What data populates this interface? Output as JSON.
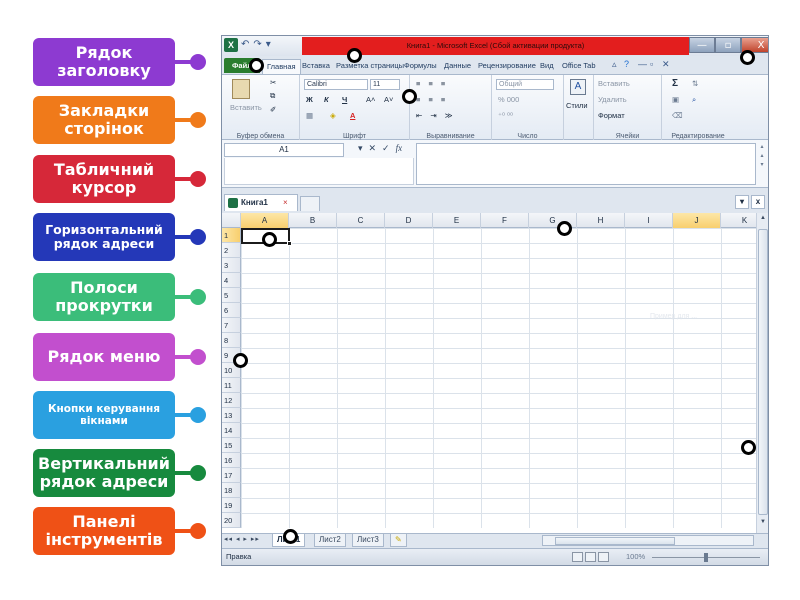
{
  "labels": [
    {
      "text": "Рядок заголовку",
      "color": "#8d3ad1"
    },
    {
      "text": "Закладки сторінок",
      "color": "#f07a1a"
    },
    {
      "text": "Табличний курсор",
      "color": "#d62839"
    },
    {
      "text": "Горизонтальний рядок адреси",
      "color": "#2438b8"
    },
    {
      "text": "Полоси прокрутки",
      "color": "#3bbd7a"
    },
    {
      "text": "Рядок меню",
      "color": "#c24fce"
    },
    {
      "text": "Кнопки керування вікнами",
      "color": "#2aa0e0"
    },
    {
      "text": "Вертикальний рядок адреси",
      "color": "#178a3e"
    },
    {
      "text": "Панелі інструментів",
      "color": "#ef5116"
    }
  ],
  "excel": {
    "title": "Книга1 - Microsoft Excel (Сбой активации продукта)",
    "qat_icon": "X",
    "qat": [
      "↶",
      "↷",
      "▾"
    ],
    "window_controls": [
      "—",
      "▫",
      "X"
    ],
    "tabs": [
      "Файл",
      "Главная",
      "Вставка",
      "Разметка страницы",
      "Формулы",
      "Данные",
      "Рецензирование",
      "Вид",
      "Office Tab"
    ],
    "tab_right_icons": [
      "▵",
      "?",
      "—",
      "▫",
      "✕"
    ],
    "ribbon": {
      "clipboard": {
        "paste": "Вставить",
        "name": "Буфер обмена"
      },
      "font": {
        "name_value": "Calibri",
        "size_value": "11",
        "bold": "Ж",
        "italic": "К",
        "underline": "Ч",
        "grow": "A˄",
        "shrink": "A˅",
        "color": "A",
        "group": "Шрифт"
      },
      "alignment": {
        "group": "Выравнивание"
      },
      "number": {
        "format": "Общий",
        "percent": "% 000",
        "group": "Число"
      },
      "styles": {
        "label": "Стили"
      },
      "cells": {
        "insert": "Вставить",
        "delete": "Удалить",
        "format": "Формат",
        "group": "Ячейки"
      },
      "editing": {
        "sum": "Σ",
        "group": "Редактирование"
      }
    },
    "name_box": "A1",
    "formula_buttons": [
      "▾",
      "✕",
      "✓",
      "fx"
    ],
    "doc_tab": {
      "label": "Книга1",
      "close": "×"
    },
    "doc_controls": [
      "▾",
      "x"
    ],
    "columns": [
      "A",
      "B",
      "C",
      "D",
      "E",
      "F",
      "G",
      "H",
      "I",
      "J",
      "K"
    ],
    "rows": [
      "1",
      "2",
      "3",
      "4",
      "5",
      "6",
      "7",
      "8",
      "9",
      "10",
      "11",
      "12",
      "13",
      "14",
      "15",
      "16",
      "17",
      "18",
      "19",
      "20"
    ],
    "selected_cell": "A1",
    "watermark": "Пример для ...",
    "sheet_nav": "◂◂ ◂ ▸ ▸▸",
    "sheets": [
      "Лист1",
      "Лист2",
      "Лист3"
    ],
    "status": "Правка",
    "zoom": "100%"
  }
}
